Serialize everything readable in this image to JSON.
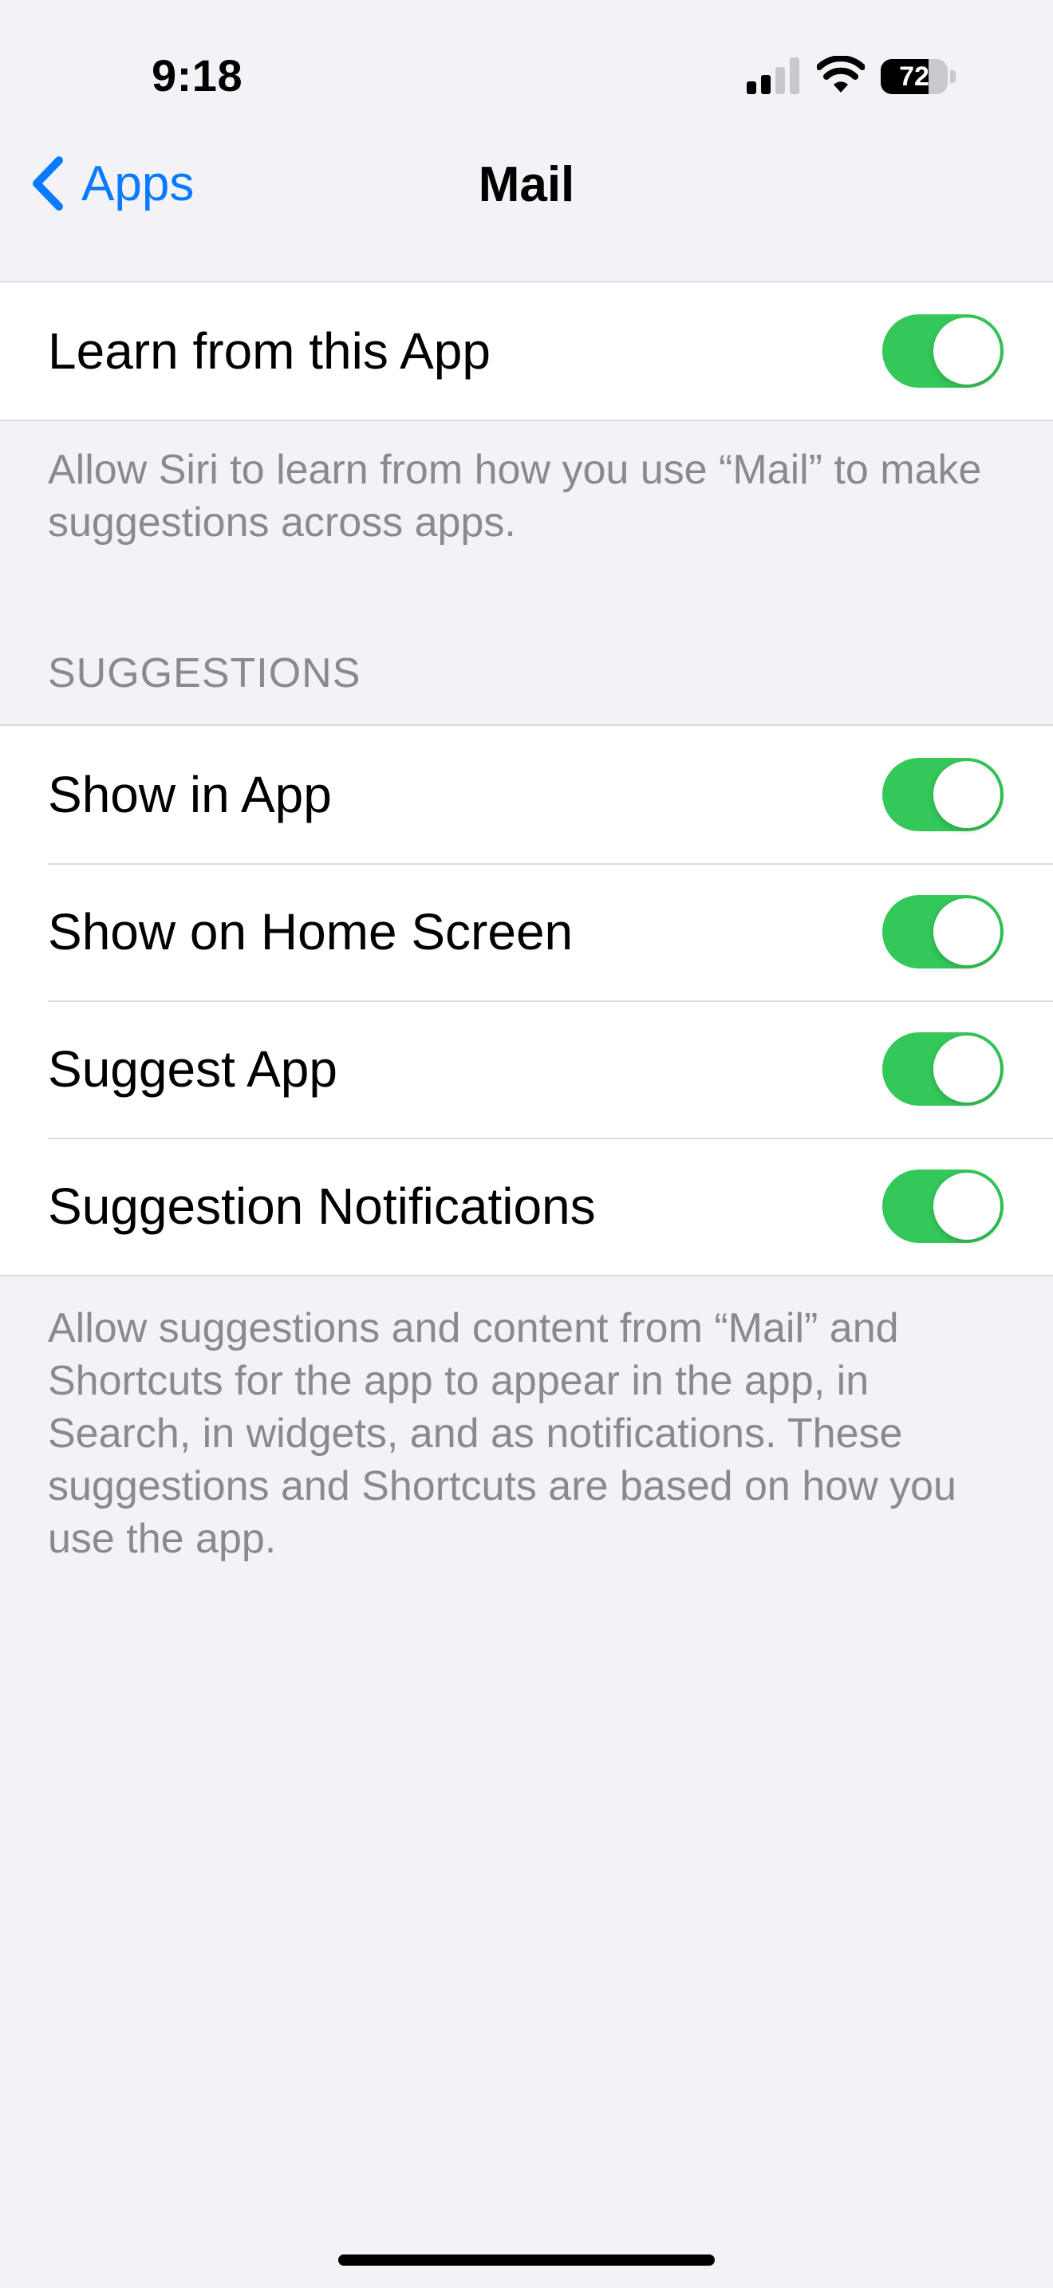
{
  "status_bar": {
    "time": "9:18",
    "battery_level": "72",
    "battery_fraction": 0.72,
    "icons": [
      "signal-icon",
      "wifi-icon",
      "battery-icon"
    ]
  },
  "nav": {
    "back_label": "Apps",
    "title": "Mail"
  },
  "learn_group": {
    "rows": [
      {
        "label": "Learn from this App",
        "on": true
      }
    ],
    "footer": "Allow Siri to learn from how you use “Mail” to make suggestions across apps."
  },
  "suggestions_group": {
    "header": "SUGGESTIONS",
    "rows": [
      {
        "label": "Show in App",
        "on": true
      },
      {
        "label": "Show on Home Screen",
        "on": true
      },
      {
        "label": "Suggest App",
        "on": true
      },
      {
        "label": "Suggestion Notifications",
        "on": true
      }
    ],
    "footer": "Allow suggestions and content from “Mail” and Shortcuts for the app to appear in the app, in Search, in widgets, and as notifications. These suggestions and Shortcuts are based on how you use the app."
  },
  "colors": {
    "accent": "#0a7aff",
    "toggle_on": "#34c759",
    "background": "#f2f2f7",
    "secondary_text": "#8a8a8e"
  }
}
